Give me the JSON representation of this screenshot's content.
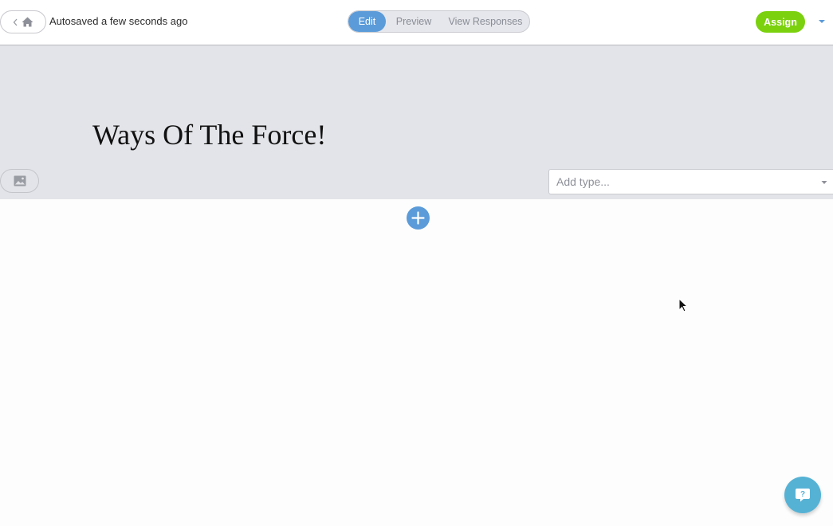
{
  "topbar": {
    "autosave_text": "Autosaved a few seconds ago",
    "modes": [
      {
        "label": "Edit",
        "active": true
      },
      {
        "label": "Preview",
        "active": false
      },
      {
        "label": "View Responses",
        "active": false
      }
    ],
    "assign_label": "Assign"
  },
  "banner": {
    "title": "Ways Of The Force!",
    "type_select_placeholder": "Add type..."
  },
  "help": {
    "glyph": "?"
  },
  "colors": {
    "accent_blue": "#5b9bd9",
    "assign_green": "#7bd10e",
    "banner_bg": "#e3e4e9",
    "help_blue": "#55b2d5"
  },
  "icons": [
    "chevron-left-icon",
    "home-icon",
    "caret-down-icon",
    "image-icon",
    "plus-icon",
    "question-bubble-icon",
    "mouse-cursor"
  ]
}
